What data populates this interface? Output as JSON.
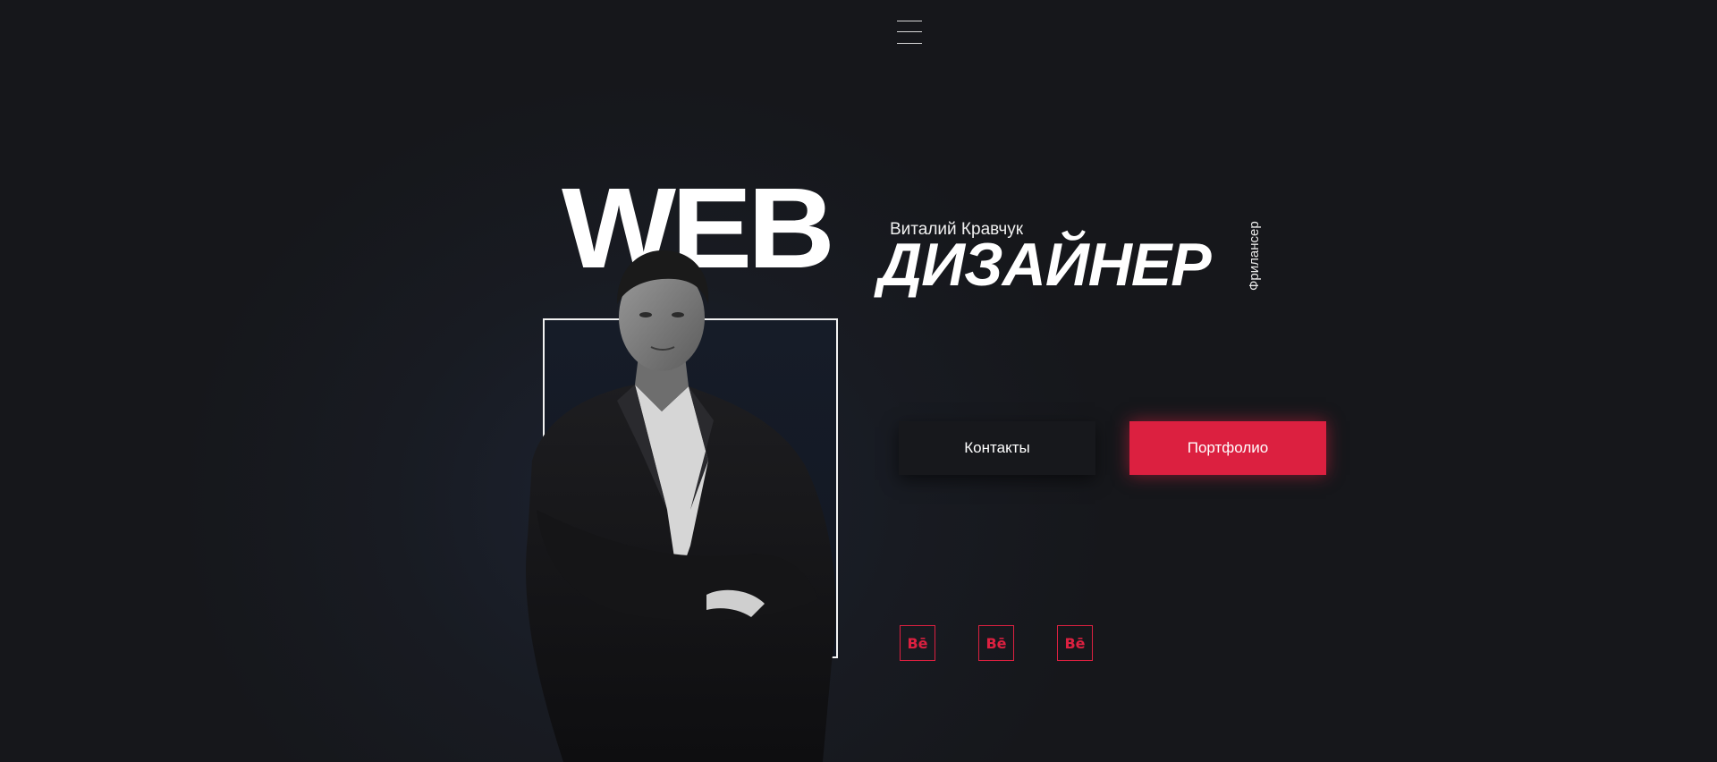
{
  "header": {
    "menu_icon": "hamburger-menu-icon"
  },
  "hero": {
    "title_word": "WEB",
    "author_name": "Виталий Кравчук",
    "designer_word": "ДИЗАЙНЕР",
    "vertical_tag": "Фрилансер"
  },
  "buttons": {
    "contacts_label": "Контакты",
    "portfolio_label": "Портфолио"
  },
  "social_links": [
    {
      "label": "Bē",
      "icon": "behance-icon"
    },
    {
      "label": "Bē",
      "icon": "behance-icon"
    },
    {
      "label": "Bē",
      "icon": "behance-icon"
    }
  ],
  "colors": {
    "background": "#16171b",
    "accent": "#dc2040",
    "text": "#ffffff",
    "button_dark": "#17181c"
  }
}
